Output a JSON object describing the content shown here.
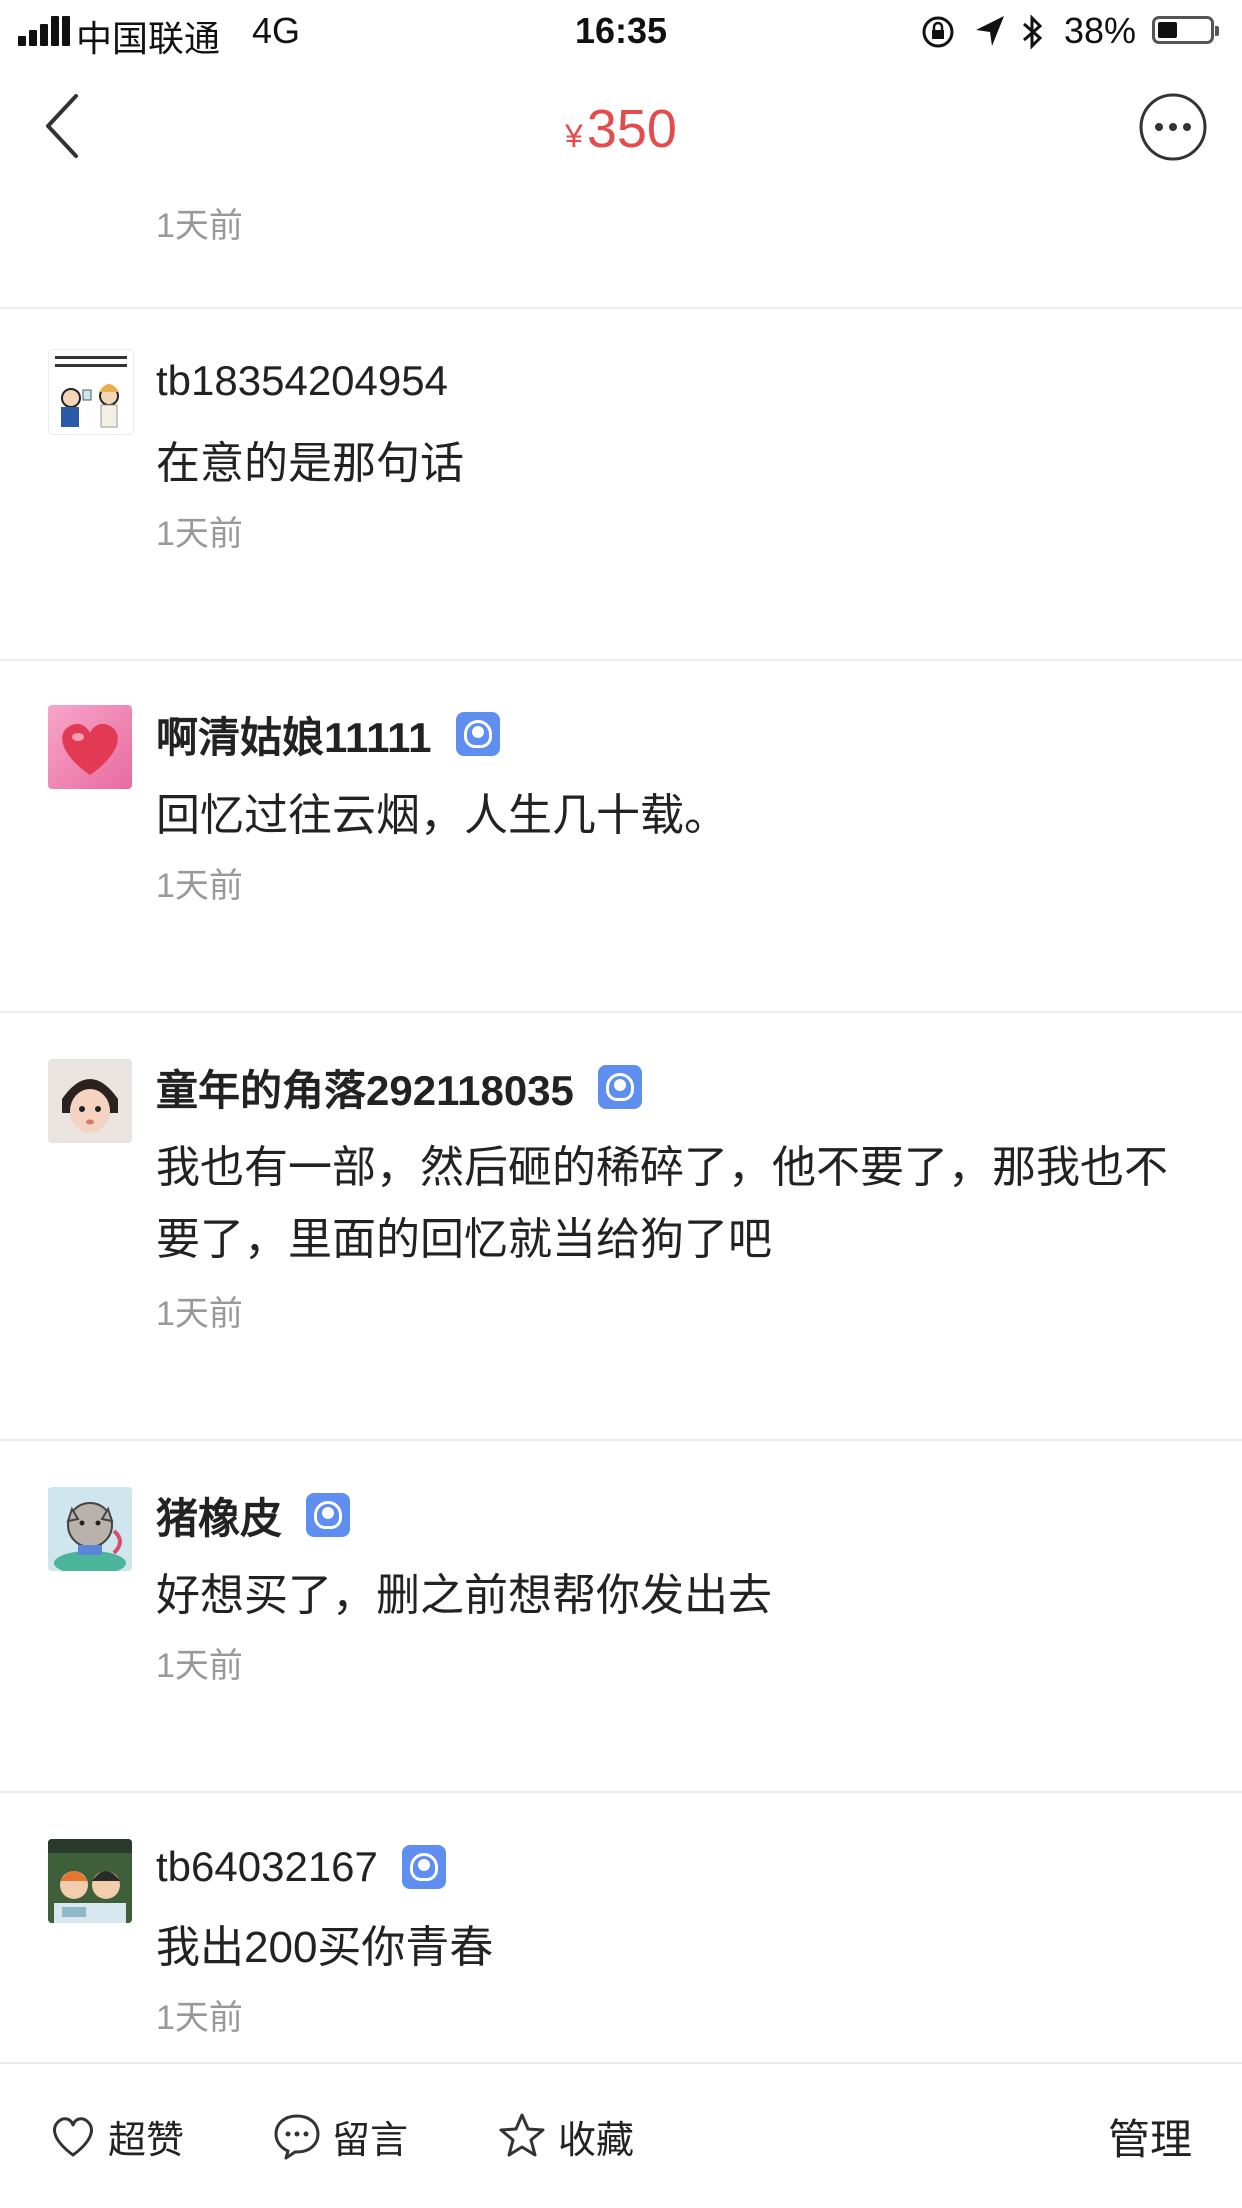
{
  "status": {
    "carrier": "中国联通",
    "network": "4G",
    "time": "16:35",
    "battery_pct": "38%",
    "battery_level": 0.38
  },
  "nav": {
    "currency": "¥",
    "price": "350",
    "back_icon": "chevron-left-icon",
    "more_icon": "more-dots-icon"
  },
  "feed": {
    "partial_time": "1天前",
    "comments": [
      {
        "username": "tb18354204954",
        "verified": false,
        "text": "在意的是那句话",
        "time": "1天前"
      },
      {
        "username": "啊清姑娘11111",
        "verified": true,
        "text": "回忆过往云烟，人生几十载。",
        "time": "1天前"
      },
      {
        "username": "童年的角落292118035",
        "verified": true,
        "text": "我也有一部，然后砸的稀碎了，他不要了，那我也不要了，里面的回忆就当给狗了吧",
        "time": "1天前"
      },
      {
        "username": "猪橡皮",
        "verified": true,
        "text": "好想买了，删之前想帮你发出去",
        "time": "1天前"
      },
      {
        "username": "tb64032167",
        "verified": true,
        "text": "我出200买你青春",
        "time": "1天前"
      }
    ]
  },
  "bottom_bar": {
    "like": "超赞",
    "comment": "留言",
    "favorite": "收藏",
    "manage": "管理"
  },
  "colors": {
    "price": "#e64b4b",
    "verify_badge": "#5d8ef0",
    "muted_text": "#999999",
    "divider": "#ececec"
  }
}
